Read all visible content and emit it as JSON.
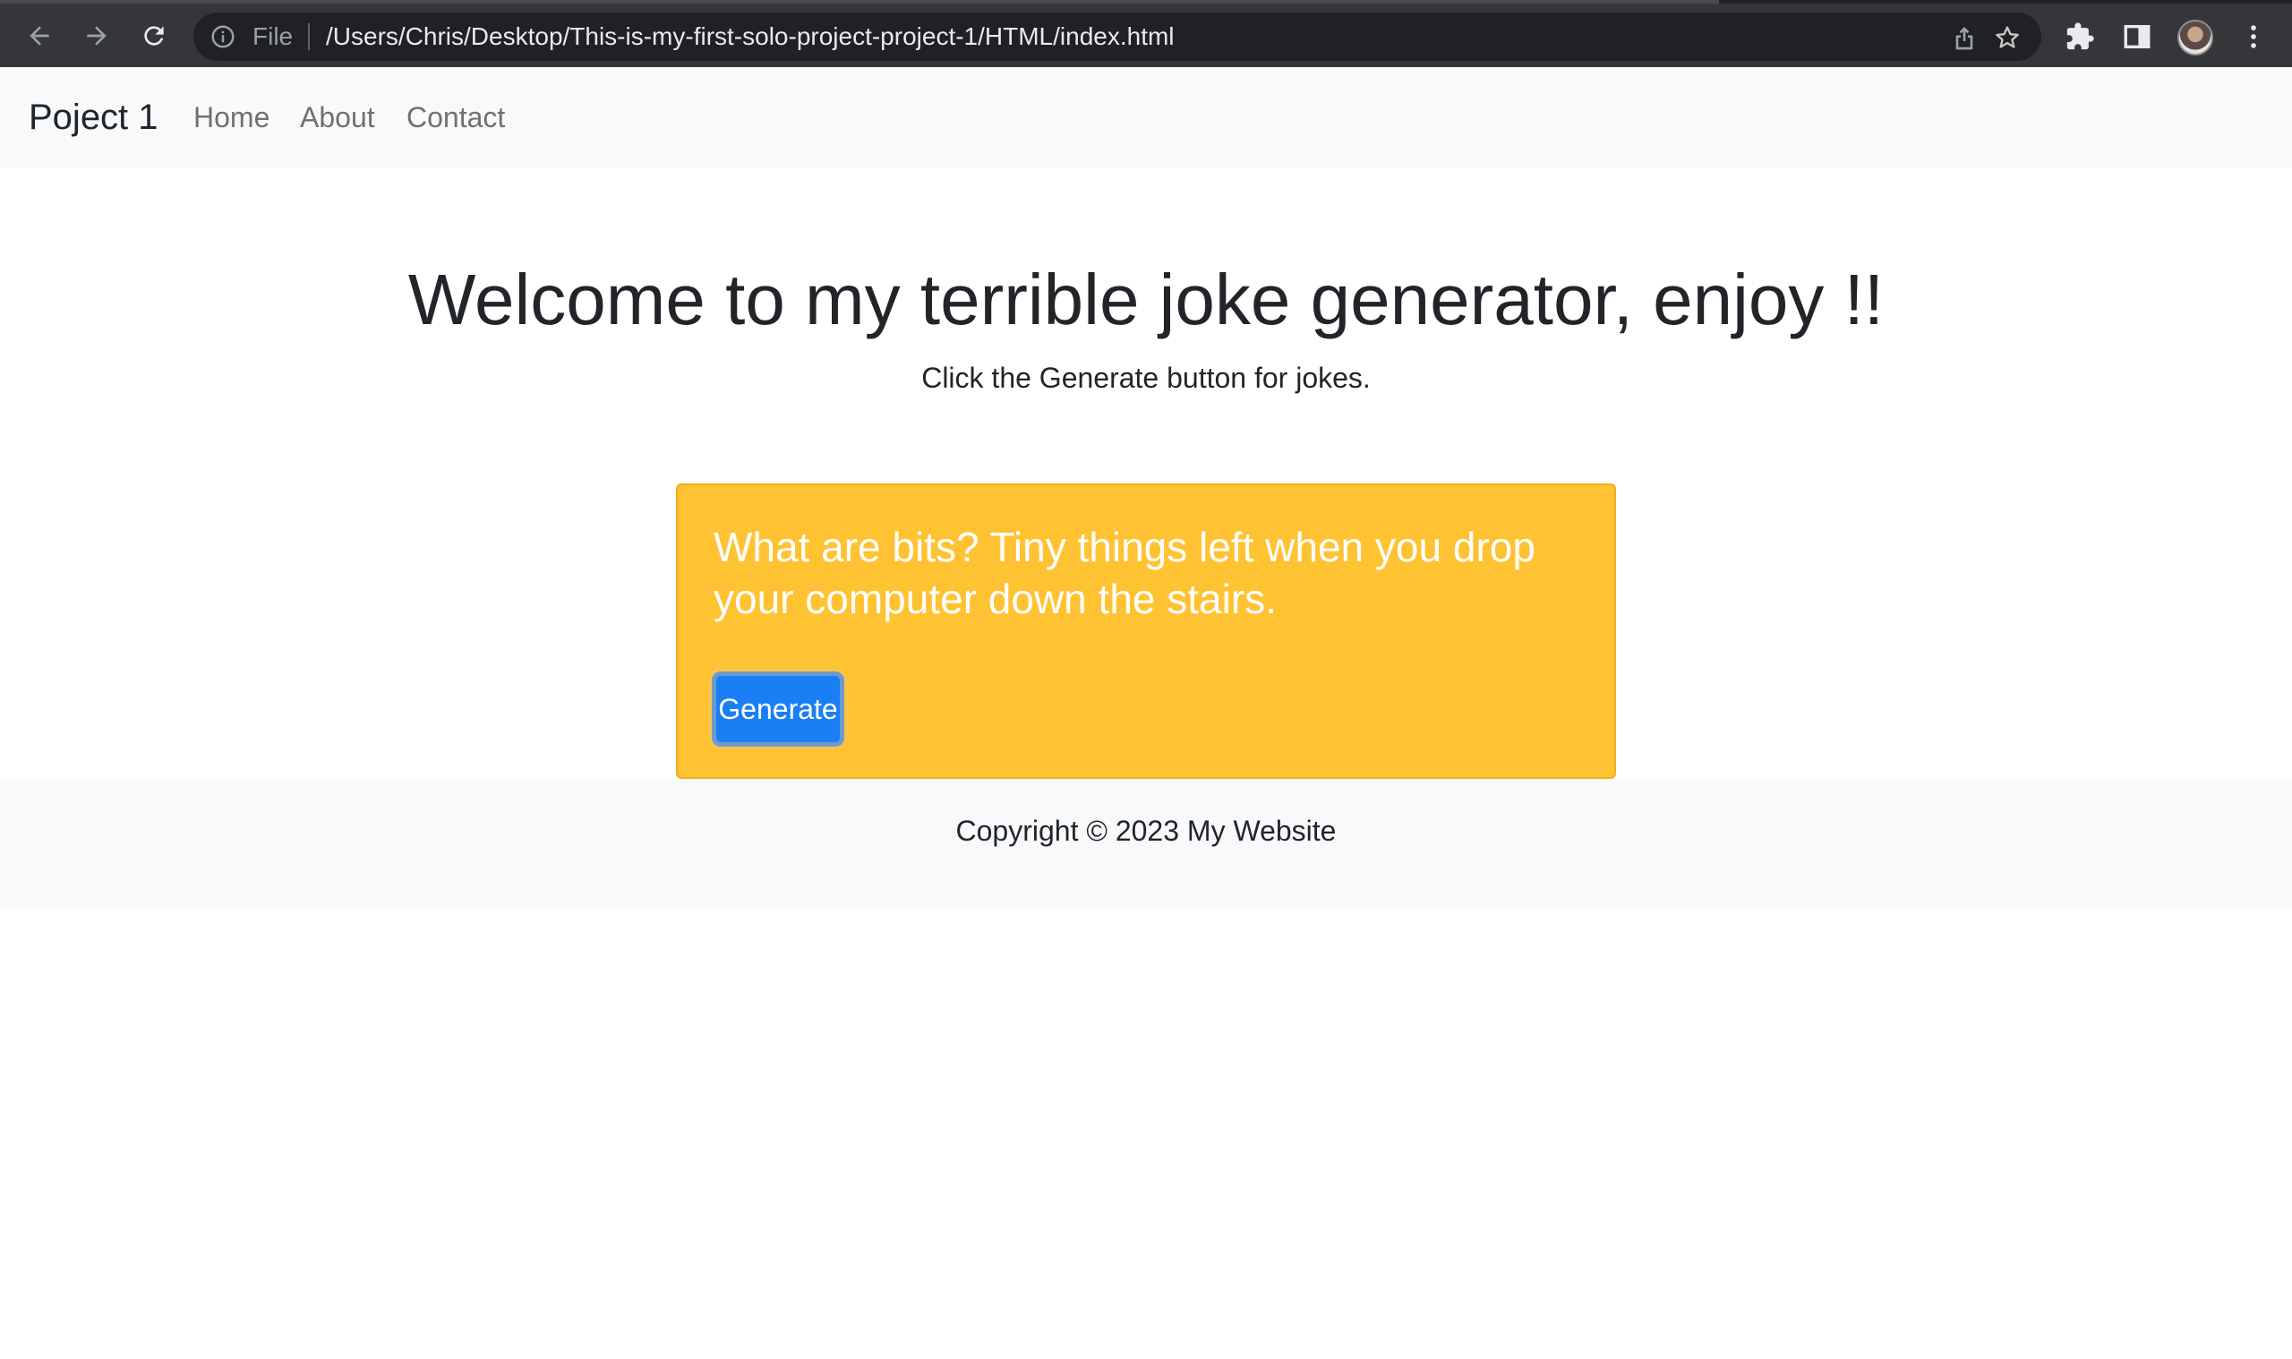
{
  "browser": {
    "scheme_label": "File",
    "url": "/Users/Chris/Desktop/This-is-my-first-solo-project-project-1/HTML/index.html",
    "icons": [
      "back-arrow-icon",
      "forward-arrow-icon",
      "reload-icon",
      "info-icon",
      "share-icon",
      "star-icon",
      "extensions-icon",
      "side-panel-icon",
      "profile-avatar",
      "kebab-menu-icon"
    ]
  },
  "navbar": {
    "brand": "Poject 1",
    "links": [
      "Home",
      "About",
      "Contact"
    ]
  },
  "hero": {
    "title": "Welcome to my terrible joke generator, enjoy !!",
    "subtitle": "Click the Generate button for jokes."
  },
  "joke_card": {
    "joke": "What are bits? Tiny things left when you drop your computer down the stairs.",
    "button_label": "Generate"
  },
  "footer": {
    "text": "Copyright © 2023 My Website"
  },
  "colors": {
    "chrome_bg": "#35363a",
    "omnibox_bg": "#202124",
    "navbar_bg": "#f8f9fa",
    "card_bg": "#ffc232",
    "button_bg": "#1a7ef5"
  }
}
